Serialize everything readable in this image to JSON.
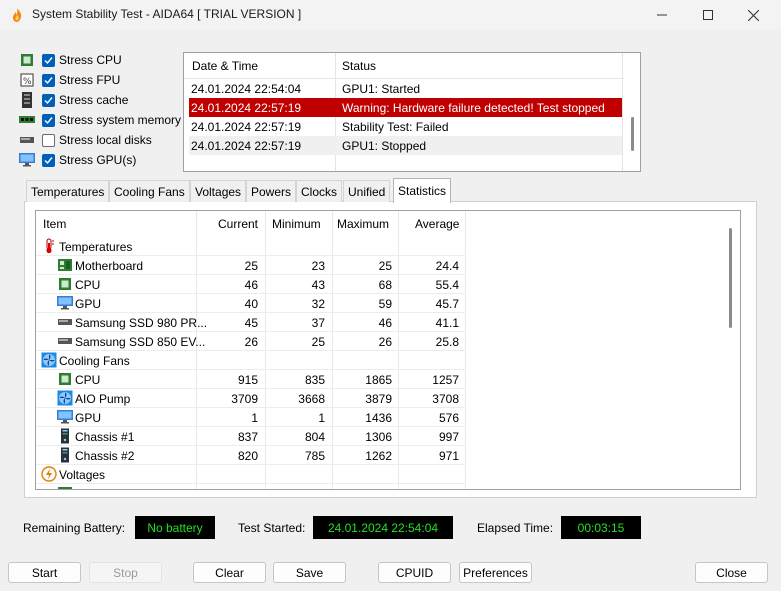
{
  "window": {
    "title": "System Stability Test - AIDA64  [ TRIAL VERSION ]",
    "icons": [
      "app-flame-icon",
      "minimize-icon",
      "maximize-icon",
      "close-icon"
    ]
  },
  "stress_options": [
    {
      "label": "Stress CPU",
      "checked": true,
      "icon": "cpu-chip-icon"
    },
    {
      "label": "Stress FPU",
      "checked": true,
      "icon": "fpu-chip-icon"
    },
    {
      "label": "Stress cache",
      "checked": true,
      "icon": "cache-icon"
    },
    {
      "label": "Stress system memory",
      "checked": true,
      "icon": "memory-icon"
    },
    {
      "label": "Stress local disks",
      "checked": false,
      "icon": "disk-icon"
    },
    {
      "label": "Stress GPU(s)",
      "checked": true,
      "icon": "gpu-monitor-icon"
    }
  ],
  "log": {
    "col_datetime": "Date & Time",
    "col_status": "Status",
    "rows": [
      {
        "datetime": "24.01.2024 22:54:04",
        "status": "GPU1: Started"
      },
      {
        "datetime": "24.01.2024 22:57:19",
        "status": "Warning: Hardware failure detected! Test stopped"
      },
      {
        "datetime": "24.01.2024 22:57:19",
        "status": "Stability Test: Failed"
      },
      {
        "datetime": "24.01.2024 22:57:19",
        "status": "GPU1: Stopped"
      }
    ],
    "highlight_color": "#c00000"
  },
  "tabs": [
    {
      "label": "Temperatures"
    },
    {
      "label": "Cooling Fans"
    },
    {
      "label": "Voltages"
    },
    {
      "label": "Powers"
    },
    {
      "label": "Clocks"
    },
    {
      "label": "Unified"
    },
    {
      "label": "Statistics",
      "active": true
    }
  ],
  "stats": {
    "headers": {
      "item": "Item",
      "current": "Current",
      "minimum": "Minimum",
      "maximum": "Maximum",
      "average": "Average"
    },
    "rows": [
      {
        "type": "group",
        "name": "Temperatures",
        "icon": "thermometer-icon"
      },
      {
        "type": "item",
        "name": "Motherboard",
        "icon": "motherboard-icon",
        "current": "25",
        "minimum": "23",
        "maximum": "25",
        "average": "24.4"
      },
      {
        "type": "item",
        "name": "CPU",
        "icon": "cpu-chip-icon",
        "current": "46",
        "minimum": "43",
        "maximum": "68",
        "average": "55.4"
      },
      {
        "type": "item",
        "name": "GPU",
        "icon": "gpu-monitor-icon",
        "current": "40",
        "minimum": "32",
        "maximum": "59",
        "average": "45.7"
      },
      {
        "type": "item",
        "name": "Samsung SSD 980 PR...",
        "icon": "disk-icon",
        "current": "45",
        "minimum": "37",
        "maximum": "46",
        "average": "41.1"
      },
      {
        "type": "item",
        "name": "Samsung SSD 850 EV...",
        "icon": "disk-icon",
        "current": "26",
        "minimum": "25",
        "maximum": "26",
        "average": "25.8"
      },
      {
        "type": "group",
        "name": "Cooling Fans",
        "icon": "fan-icon"
      },
      {
        "type": "item",
        "name": "CPU",
        "icon": "cpu-chip-icon",
        "current": "915",
        "minimum": "835",
        "maximum": "1865",
        "average": "1257"
      },
      {
        "type": "item",
        "name": "AIO Pump",
        "icon": "fan-icon",
        "current": "3709",
        "minimum": "3668",
        "maximum": "3879",
        "average": "3708"
      },
      {
        "type": "item",
        "name": "GPU",
        "icon": "gpu-monitor-icon",
        "current": "1",
        "minimum": "1",
        "maximum": "1436",
        "average": "576"
      },
      {
        "type": "item",
        "name": "Chassis #1",
        "icon": "chassis-icon",
        "current": "837",
        "minimum": "804",
        "maximum": "1306",
        "average": "997"
      },
      {
        "type": "item",
        "name": "Chassis #2",
        "icon": "chassis-icon",
        "current": "820",
        "minimum": "785",
        "maximum": "1262",
        "average": "971"
      },
      {
        "type": "group",
        "name": "Voltages",
        "icon": "voltage-icon"
      }
    ]
  },
  "status_bar": {
    "battery_label": "Remaining Battery:",
    "battery_value": "No battery",
    "started_label": "Test Started:",
    "started_value": "24.01.2024 22:54:04",
    "elapsed_label": "Elapsed Time:",
    "elapsed_value": "00:03:15",
    "value_color": "#22e022"
  },
  "buttons": {
    "start": "Start",
    "stop": "Stop",
    "clear": "Clear",
    "save": "Save",
    "cpuid": "CPUID",
    "preferences": "Preferences",
    "close": "Close"
  }
}
